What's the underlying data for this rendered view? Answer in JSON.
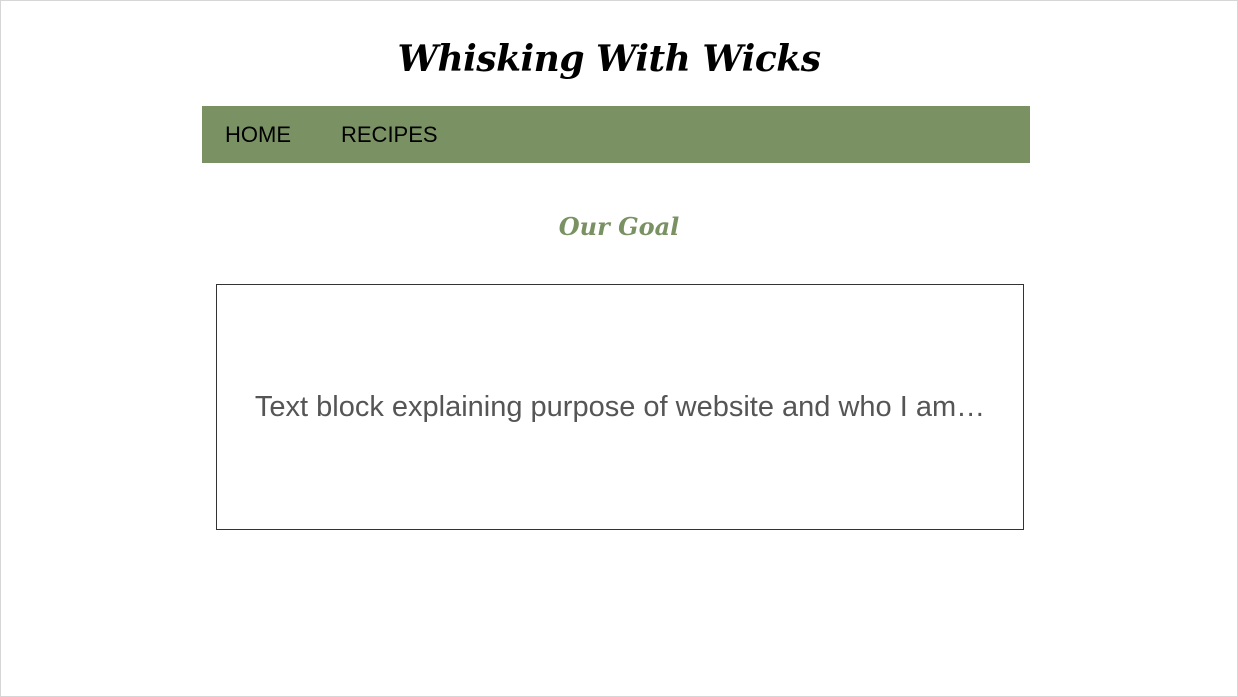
{
  "site": {
    "title": "Whisking With Wicks"
  },
  "nav": {
    "items": [
      {
        "label": "HOME"
      },
      {
        "label": "RECIPES"
      }
    ]
  },
  "main": {
    "heading": "Our Goal",
    "text_block": "Text block explaining purpose of website and who I am…"
  },
  "colors": {
    "accent_green": "#7a9263",
    "text_gray": "#555555",
    "border": "#333333"
  }
}
